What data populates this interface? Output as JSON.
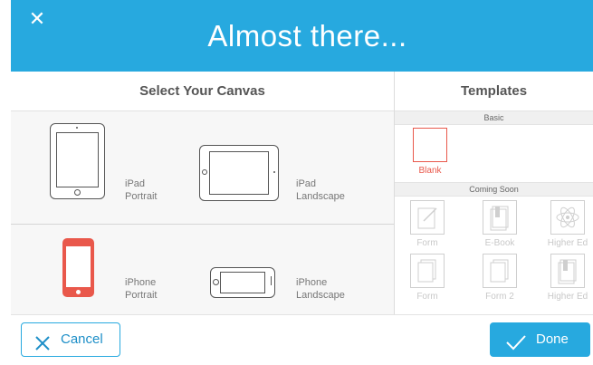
{
  "header": {
    "title": "Almost there...",
    "close_icon": "close-icon",
    "close_glyph": "✕"
  },
  "canvas_panel": {
    "heading": "Select Your Canvas",
    "options": [
      {
        "label_line1": "iPad",
        "label_line2": "Portrait",
        "icon": "ipad-portrait-icon"
      },
      {
        "label_line1": "iPad",
        "label_line2": "Landscape",
        "icon": "ipad-landscape-icon"
      },
      {
        "label_line1": "iPhone",
        "label_line2": "Portrait",
        "icon": "iphone-portrait-icon",
        "selected": true
      },
      {
        "label_line1": "iPhone",
        "label_line2": "Landscape",
        "icon": "iphone-landscape-icon"
      }
    ]
  },
  "templates_panel": {
    "heading": "Templates",
    "basic_label": "Basic",
    "coming_soon_label": "Coming Soon",
    "basic": [
      {
        "name": "Blank",
        "icon": "blank-page-icon"
      }
    ],
    "coming_soon": [
      {
        "name": "Form",
        "icon": "pencil-note-icon"
      },
      {
        "name": "E-Book",
        "icon": "book-icon"
      },
      {
        "name": "Higher Ed",
        "icon": "atom-icon"
      },
      {
        "name": "Form",
        "icon": "stacked-pages-icon"
      },
      {
        "name": "Form 2",
        "icon": "stacked-pages-icon"
      },
      {
        "name": "Higher Ed",
        "icon": "book-icon"
      }
    ]
  },
  "footer": {
    "cancel_label": "Cancel",
    "done_label": "Done"
  },
  "colors": {
    "accent": "#27a9df",
    "selected": "#e9584b"
  }
}
